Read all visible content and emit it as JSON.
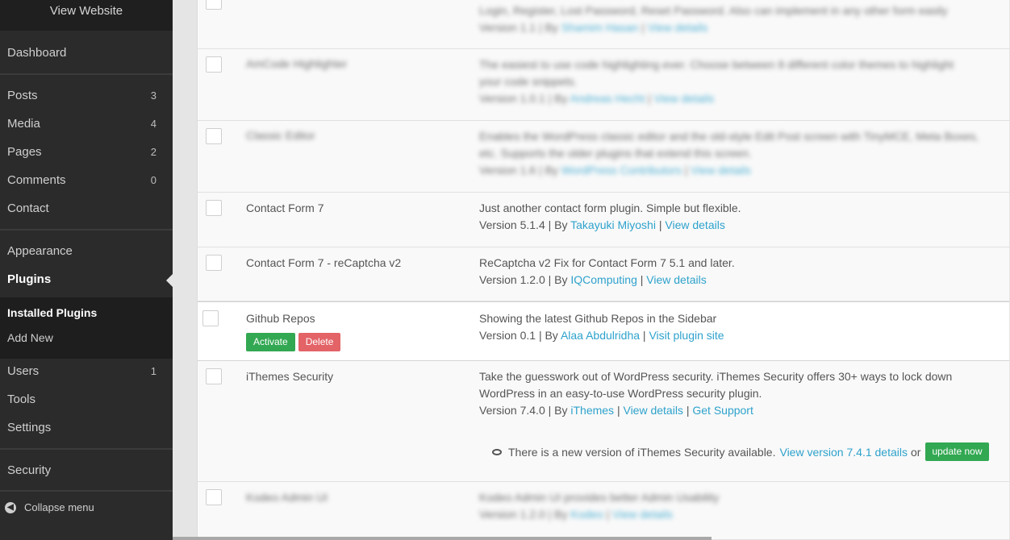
{
  "sidebar": {
    "view_website": "View Website",
    "dashboard": "Dashboard",
    "posts": {
      "label": "Posts",
      "count": "3"
    },
    "media": {
      "label": "Media",
      "count": "4"
    },
    "pages": {
      "label": "Pages",
      "count": "2"
    },
    "comments": {
      "label": "Comments",
      "count": "0"
    },
    "contact": "Contact",
    "appearance": "Appearance",
    "plugins": "Plugins",
    "installed_plugins": "Installed Plugins",
    "add_new": "Add New",
    "users": {
      "label": "Users",
      "count": "1"
    },
    "tools": "Tools",
    "settings": "Settings",
    "security": "Security",
    "collapse_menu": "Collapse menu"
  },
  "plugins": [
    {
      "name": "",
      "desc_line1": "Login, Register, Lost Password, Reset Password. Also can implement in any other form easily",
      "version": "Version 1.1 | By",
      "author": "Shamim Hasan",
      "sep": "|",
      "link": "View details",
      "blurred": true
    },
    {
      "name": "AmCode Highlighter",
      "desc_line1": "The easiest to use code highlighting ever. Choose between 8 different color themes to highlight",
      "desc_line2": "your code snippets.",
      "version": "Version 1.0.1 | By",
      "author": "Andreas Hecht",
      "sep": "|",
      "link": "View details",
      "blurred": true
    },
    {
      "name": "Classic Editor",
      "desc_line1": "Enables the WordPress classic editor and the old-style Edit Post screen with TinyMCE, Meta Boxes,",
      "desc_line2": "etc. Supports the older plugins that extend this screen.",
      "version": "Version 1.6 | By",
      "author": "WordPress Contributors",
      "sep": "|",
      "link": "View details",
      "blurred": true
    },
    {
      "name": "Contact Form 7",
      "desc_line1": "Just another contact form plugin. Simple but flexible.",
      "version": "Version 5.1.4 | By",
      "author": "Takayuki Miyoshi",
      "sep": "|",
      "link": "View details"
    },
    {
      "name": "Contact Form 7 - reCaptcha v2",
      "desc_line1": "ReCaptcha v2 Fix for Contact Form 7 5.1 and later.",
      "version": "Version 1.2.0 | By",
      "author": "IQComputing",
      "sep": "|",
      "link": "View details"
    },
    {
      "name": "Github Repos",
      "desc_line1": "Showing the latest Github Repos in the Sidebar",
      "version": "Version 0.1 | By",
      "author": "Alaa Abdulridha",
      "sep": "|",
      "link": "Visit plugin site",
      "activate": "Activate",
      "delete": "Delete"
    },
    {
      "name": "iThemes Security",
      "desc_line1": "Take the guesswork out of WordPress security. iThemes Security offers 30+ ways to lock down",
      "desc_line2": "WordPress in an easy-to-use WordPress security plugin.",
      "version": "Version 7.4.0 | By",
      "author": "iThemes",
      "sep": "|",
      "link": "View details",
      "sep2": "|",
      "link2": "Get Support",
      "notice_text": "There is a new version of iThemes Security available.",
      "notice_link": "View version 7.4.1 details",
      "notice_or": "or",
      "update_now": "update now"
    },
    {
      "name": "Kodeo Admin UI",
      "desc_line1": "Kodeo Admin UI provides better Admin Usability",
      "version": "Version 1.2.0 | By",
      "author": "Kodeo",
      "sep": "|",
      "link": "View details",
      "blurred": true
    }
  ]
}
